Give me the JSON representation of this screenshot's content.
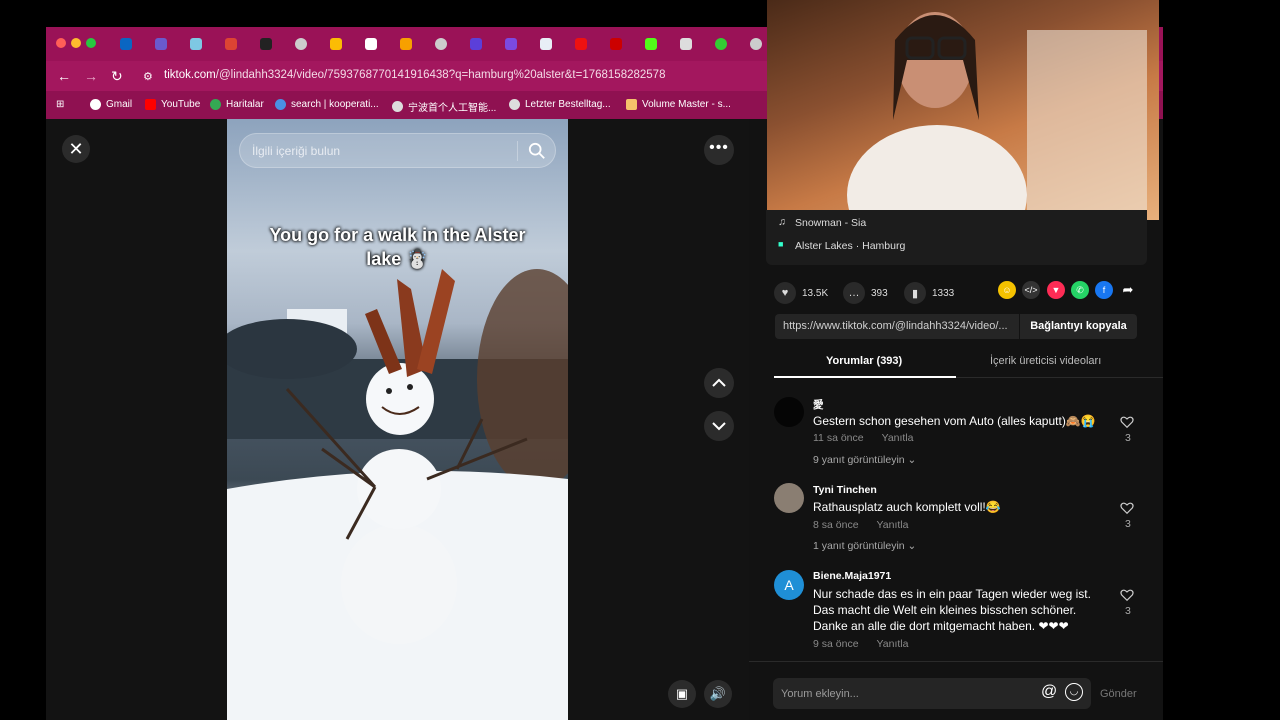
{
  "browser": {
    "url_host": "tiktok.com",
    "url_rest": "/@lindahh3324/video/7593768770141916438?q=hamburg%20alster&t=1768158282578",
    "bookmarks": [
      "Gmail",
      "YouTube",
      "Haritalar",
      "search | kooperati...",
      "宁波首个人工智能...",
      "Letzter Bestelltag...",
      "Volume Master - s..."
    ]
  },
  "player": {
    "search_placeholder": "İlgili içeriği bulun",
    "caption_line1": "You go for a walk in the Alster",
    "caption_line2": "lake ☃️"
  },
  "video_info": {
    "music": "Snowman - Sia",
    "location": "Alster Lakes · Hamburg"
  },
  "stats": {
    "likes": "13.5K",
    "comments": "393",
    "saves": "1333"
  },
  "link": {
    "url": "https://www.tiktok.com/@lindahh3324/video/...",
    "copy_label": "Bağlantıyı kopyala"
  },
  "tabs": {
    "comments": "Yorumlar (393)",
    "creator_videos": "İçerik üreticisi videoları"
  },
  "comments": [
    {
      "user": "愛",
      "text": "Gestern schon gesehen vom Auto (alles kaputt)🙈😭",
      "time": "11 sa önce",
      "reply": "Yanıtla",
      "likes": "3",
      "replies": "9 yanıt görüntüleyin ⌄"
    },
    {
      "user": "Tyni Tinchen",
      "text": "Rathausplatz auch komplett voll!😂",
      "time": "8 sa önce",
      "reply": "Yanıtla",
      "likes": "3",
      "replies": "1 yanıt görüntüleyin ⌄"
    },
    {
      "user": "Biene.Maja1971",
      "text": "Nur schade das es in ein paar Tagen wieder weg ist. Das macht die Welt ein kleines bisschen schöner. Danke an alle die dort mitgemacht haben. ❤❤❤",
      "time": "9 sa önce",
      "reply": "Yanıtla",
      "likes": "3",
      "avatar_letter": "A"
    }
  ],
  "input": {
    "placeholder": "Yorum ekleyin...",
    "send": "Gönder"
  },
  "colors": {
    "browser_tabbar": "#9a1257",
    "accent_red": "#fe2c55",
    "avatar_blue": "#1f8fd6"
  }
}
